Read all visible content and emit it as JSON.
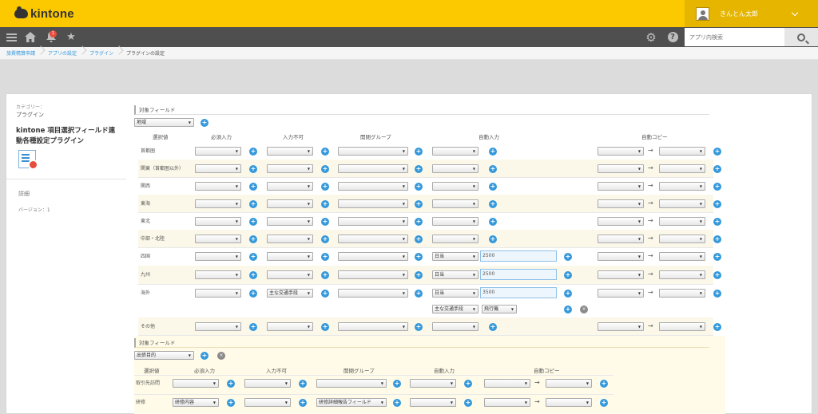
{
  "header": {
    "logo_text": "kintone",
    "user_name": "きんとん太郎",
    "notification_count": "1",
    "search_placeholder": "アプリ内検索"
  },
  "breadcrumb": [
    "旅費精算申請",
    "アプリの設定",
    "プラグイン",
    "プラグインの設定"
  ],
  "sidebar": {
    "category_label": "カテゴリー：",
    "category_value": "プラグイン",
    "plugin_title": "kintone 項目選択フィールド連動各種設定プラグイン",
    "detail_label": "詳細",
    "version_label": "バージョン：1"
  },
  "config1": {
    "section_title": "対象フィールド",
    "field_select": "地域",
    "columns": {
      "choice": "選択値",
      "required": "必須入力",
      "readonly": "入力不可",
      "group": "開閉グループ",
      "autofill": "自動入力",
      "autocopy": "自動コピー"
    },
    "rows": [
      {
        "label": "首都圏"
      },
      {
        "label": "関東（首都圏以外）"
      },
      {
        "label": "関西"
      },
      {
        "label": "東海"
      },
      {
        "label": "東北"
      },
      {
        "label": "中部・北陸"
      },
      {
        "label": "四国",
        "auto_field": "日当",
        "auto_value": "2500"
      },
      {
        "label": "九州",
        "auto_field": "日当",
        "auto_value": "2500"
      },
      {
        "label": "海外",
        "readonly": "主な交通手段",
        "auto_field": "日当",
        "auto_value": "3500",
        "auto_field2": "主な交通手段",
        "auto_value2": "飛行機"
      },
      {
        "label": "その他"
      }
    ]
  },
  "config2": {
    "section_title": "対象フィールド",
    "field_select": "出張目的",
    "columns": {
      "choice": "選択値",
      "required": "必須入力",
      "readonly": "入力不可",
      "group": "開閉グループ",
      "autofill": "自動入力",
      "autocopy": "自動コピー"
    },
    "rows": [
      {
        "label": "取引先訪問"
      },
      {
        "label": "研修",
        "required": "研修内容",
        "group": "研修詳細報告フィールド"
      }
    ]
  },
  "icons": {
    "arrow": "→",
    "plus": "+",
    "remove": "×"
  },
  "colors": {
    "brand": "#fcc800",
    "navbar": "#4f4f4f",
    "accent": "#3498db"
  }
}
